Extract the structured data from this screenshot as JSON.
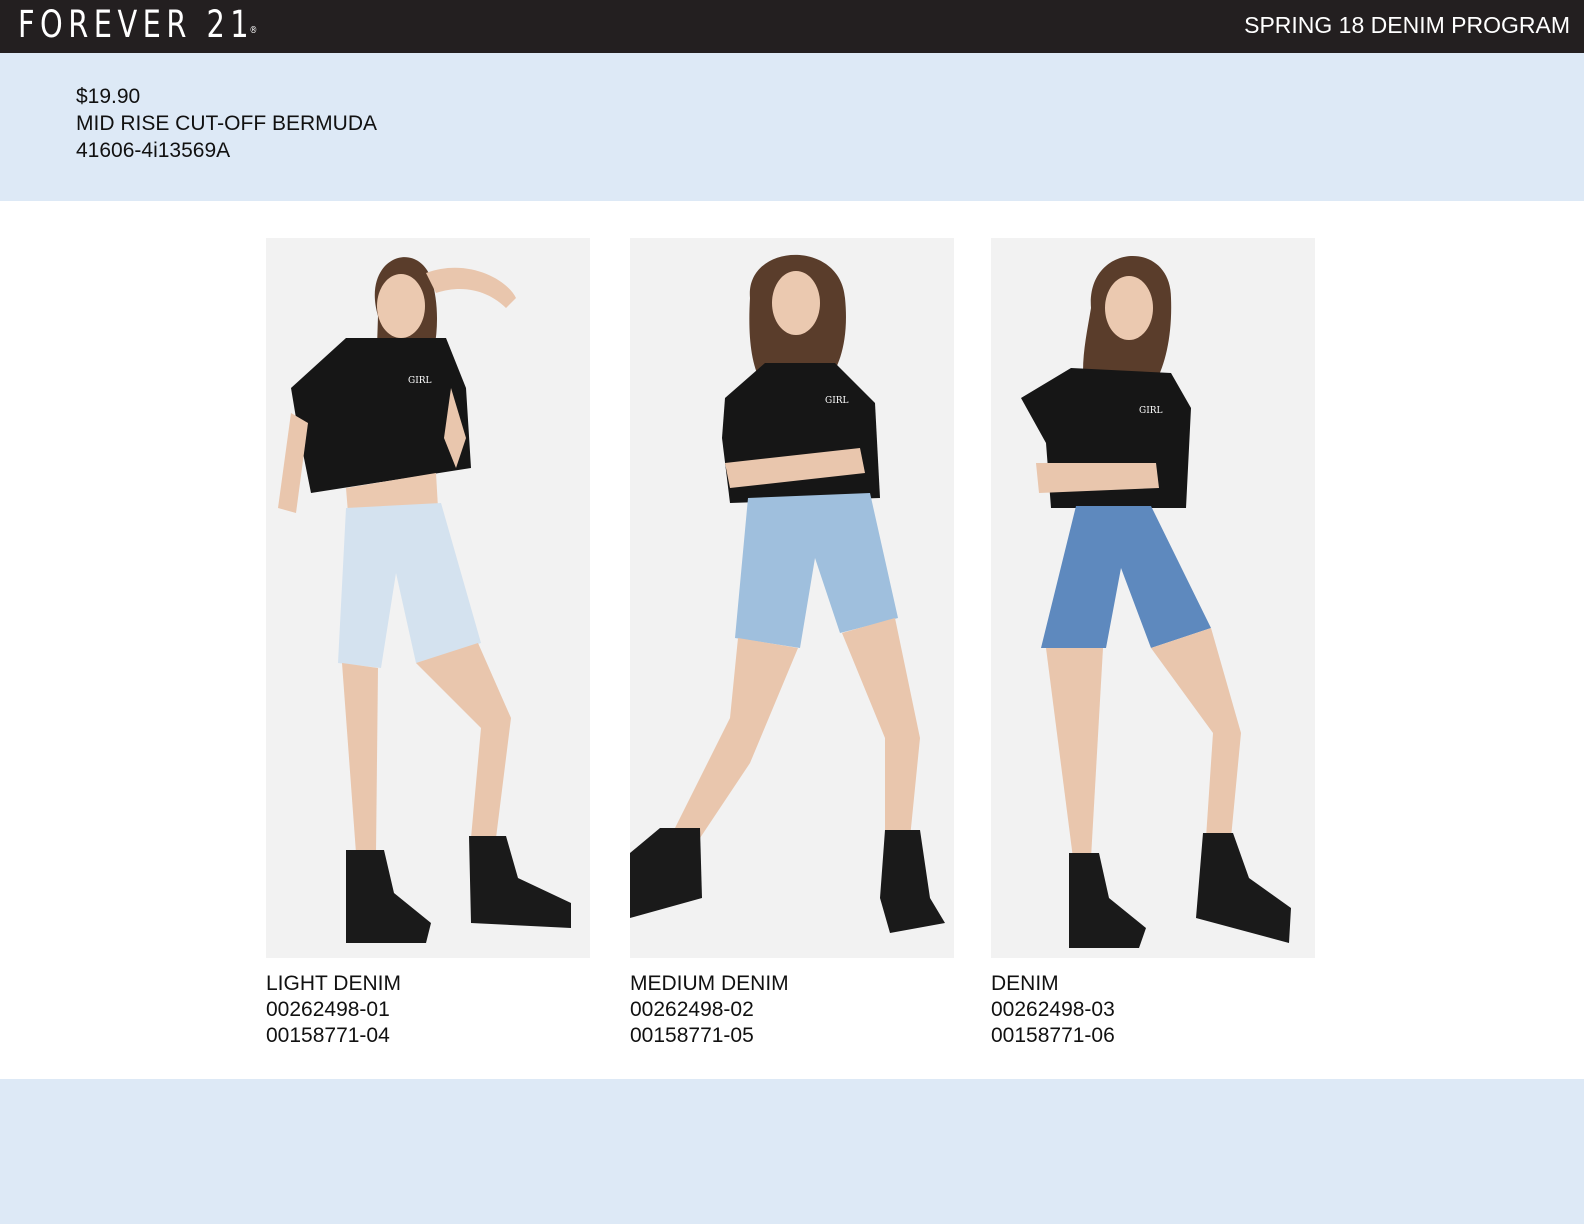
{
  "header": {
    "brand": "FOREVER 21",
    "brand_mark": "®",
    "program": "SPRING 18 DENIM PROGRAM"
  },
  "product": {
    "price": "$19.90",
    "name": "MID RISE CUT-OFF BERMUDA",
    "style_number": "41606-4i13569A"
  },
  "variants": [
    {
      "wash": "LIGHT DENIM",
      "codes": [
        "00262498-01",
        "00158771-04"
      ],
      "shorts_color": "#d4e2ef"
    },
    {
      "wash": "MEDIUM DENIM",
      "codes": [
        "00262498-02",
        "00158771-05"
      ],
      "shorts_color": "#9fbfdd"
    },
    {
      "wash": "DENIM",
      "codes": [
        "00262498-03",
        "00158771-06"
      ],
      "shorts_color": "#5e89be"
    }
  ],
  "colors": {
    "header_bg": "#231f20",
    "band_bg": "#dde9f6",
    "photo_bg": "#f2f2f2"
  }
}
